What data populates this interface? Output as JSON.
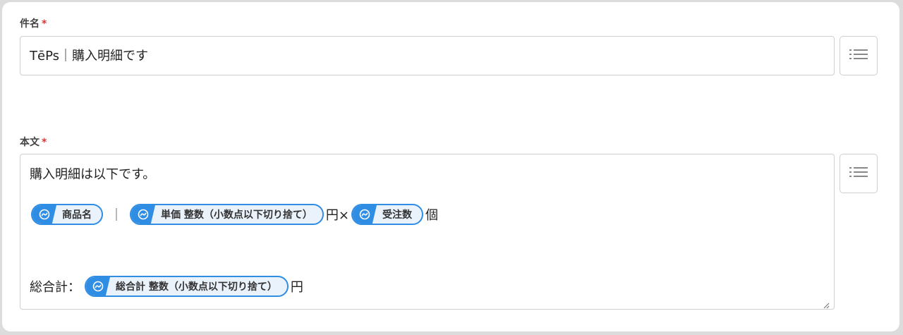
{
  "subject": {
    "label": "件名",
    "required_mark": "*",
    "value": "TēPs｜購入明細です",
    "insert_button_icon": "list-icon"
  },
  "body": {
    "label": "本文",
    "required_mark": "*",
    "line1": "購入明細は以下です。",
    "line2": {
      "chip1": "商品名",
      "separator": "｜",
      "chip2": "単価 整数（小数点以下切り捨て）",
      "text_after_chip2": "円×",
      "chip3": "受注数",
      "text_after_chip3": "個"
    },
    "line3": {
      "prefix": "総合計：",
      "chip": "総合計 整数（小数点以下切り捨て）",
      "suffix": "円"
    },
    "insert_button_icon": "list-icon"
  },
  "colors": {
    "chip_border": "#2f8de4",
    "chip_fill": "#eaf2fc",
    "required": "#d43b3b"
  }
}
